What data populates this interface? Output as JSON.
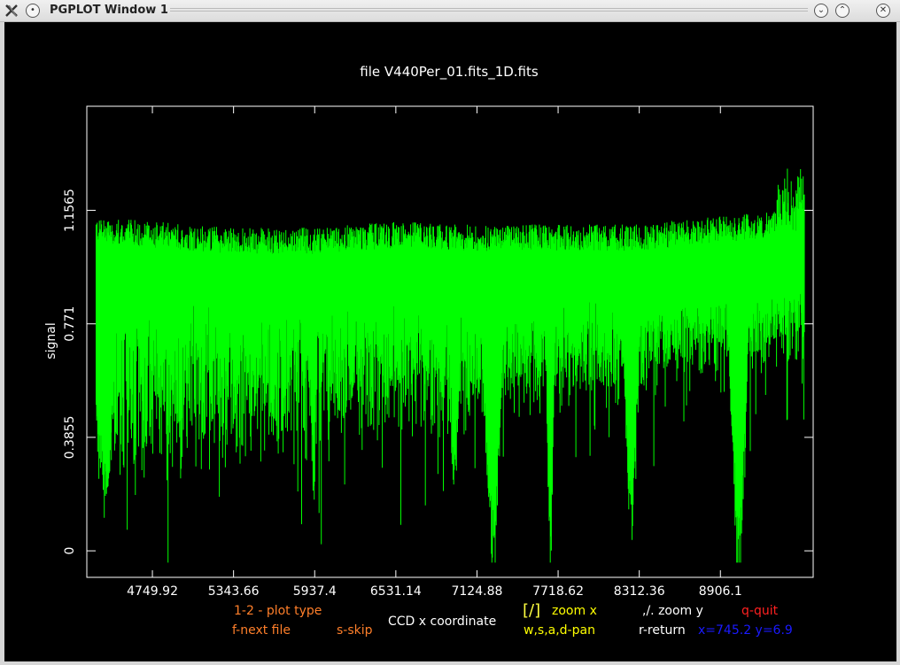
{
  "window": {
    "title": "PGPLOT Window 1",
    "icons": [
      "x-logo-icon",
      "menu-icon",
      "minimize-icon",
      "maximize-icon",
      "close-icon"
    ]
  },
  "plot": {
    "title": "file V440Per_01.fits_1D.fits",
    "xlabel": "CCD x coordinate",
    "ylabel": "signal",
    "x_ticks": [
      "4749.92",
      "5343.66",
      "5937.4",
      "6531.14",
      "7124.88",
      "7718.62",
      "8312.36",
      "8906.1"
    ],
    "y_ticks": [
      "1.1565",
      "0.771",
      "0.3855",
      "0"
    ],
    "colors": {
      "trace": "#00ff00",
      "axes": "#ffffff",
      "background": "#000000"
    }
  },
  "chart_data": {
    "type": "line",
    "title": "file V440Per_01.fits_1D.fits",
    "xlabel": "CCD x coordinate",
    "ylabel": "signal",
    "xlim": [
      4270,
      9585
    ],
    "ylim": [
      -0.09,
      1.51
    ],
    "x_ticks": [
      4749.92,
      5343.66,
      5937.4,
      6531.14,
      7124.88,
      7718.62,
      8312.36,
      8906.1
    ],
    "y_ticks": [
      0,
      0.3855,
      0.771,
      1.1565
    ],
    "series": [
      {
        "color": "#00ff00",
        "continuum": [
          [
            4338,
            1.08
          ],
          [
            4750,
            1.06
          ],
          [
            5344,
            1.04
          ],
          [
            5937,
            1.04
          ],
          [
            6531,
            1.06
          ],
          [
            7125,
            1.05
          ],
          [
            7719,
            1.05
          ],
          [
            8312,
            1.05
          ],
          [
            8906,
            1.08
          ],
          [
            9520,
            1.1
          ]
        ],
        "absorption_features": [
          {
            "x": 4400,
            "depth": 0.9,
            "width": 110
          },
          {
            "x": 5930,
            "depth": 0.95,
            "width": 20
          },
          {
            "x": 6960,
            "depth": 0.8,
            "width": 60
          },
          {
            "x": 7240,
            "depth": 1.05,
            "width": 90
          },
          {
            "x": 7660,
            "depth": 1.08,
            "width": 35
          },
          {
            "x": 8255,
            "depth": 0.98,
            "width": 70
          },
          {
            "x": 9040,
            "depth": 1.15,
            "width": 80
          }
        ],
        "max": 1.48,
        "min": -0.04
      }
    ]
  },
  "status": {
    "plot_type": "1-2 - plot type",
    "next_file": "f-next file",
    "skip": "s-skip",
    "xlabel": "CCD x coordinate",
    "zoom_x_key": "[/]",
    "zoom_x": "zoom x",
    "pan": "w,s,a,d-pan",
    "zoom_y": ",/. zoom y",
    "quit": "q-quit",
    "return": "r-return",
    "cursor": "x=745.2 y=6.9",
    "colors": {
      "orange": "#ff7f2a",
      "white": "#ffffff",
      "yellow": "#ffff00",
      "red": "#ff2020",
      "blue": "#1a1aff",
      "yellow_key": "#ffff40"
    }
  }
}
